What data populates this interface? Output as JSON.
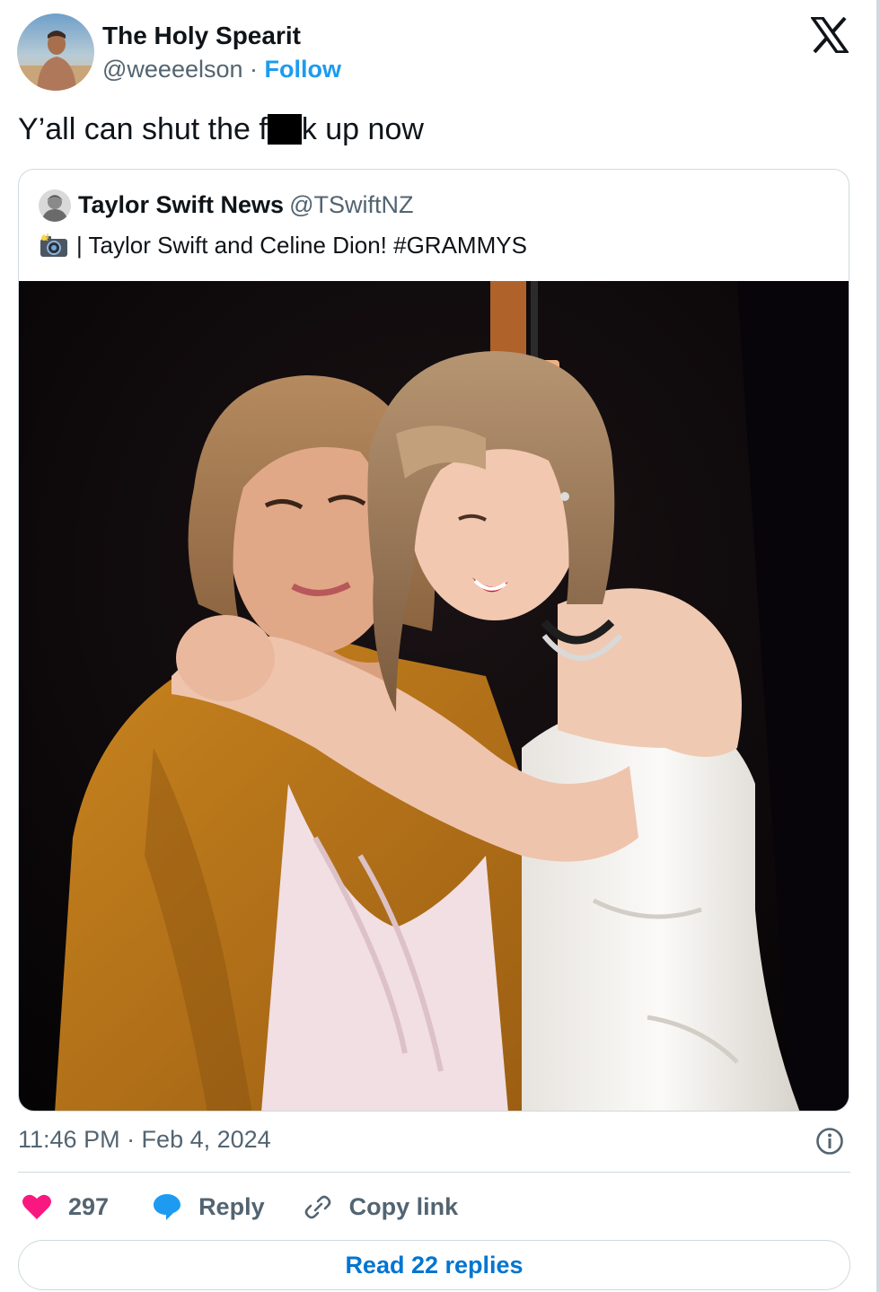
{
  "author": {
    "display_name": "The Holy Spearit",
    "handle": "@weeeelson",
    "separator": " · ",
    "follow_label": "Follow"
  },
  "brand_icon": "x-logo-icon",
  "tweet": {
    "text_before": "Y’all can shut the f",
    "text_after": "k up now"
  },
  "quoted_tweet": {
    "display_name": "Taylor Swift News",
    "handle": "@TSwiftNZ",
    "text": "| Taylor Swift and Celine Dion! #GRAMMYS",
    "leading_icon": "camera-flash-icon"
  },
  "meta": {
    "timestamp": "11:46 PM · Feb 4, 2024"
  },
  "actions": {
    "like_count": "297",
    "reply_label": "Reply",
    "copy_label": "Copy link"
  },
  "read_replies_label": "Read 22 replies",
  "colors": {
    "link_blue": "#1d9bf0",
    "heart_pink": "#f91880",
    "muted_text": "#536471",
    "border": "#cfd9de"
  }
}
